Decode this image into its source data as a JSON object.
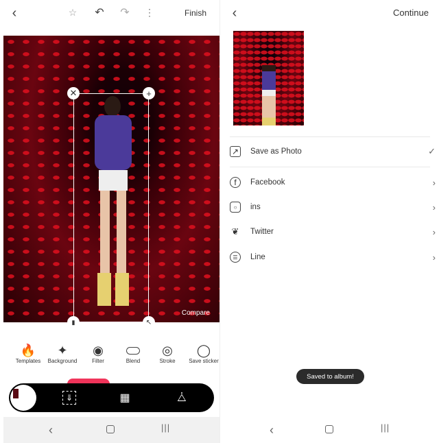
{
  "editor": {
    "header": {
      "finish_label": "Finish"
    },
    "compare_label": "Compare",
    "tools": [
      {
        "label": "Templates",
        "icon": "flame-icon"
      },
      {
        "label": "Background",
        "icon": "magic-wand-icon"
      },
      {
        "label": "Filter",
        "icon": "palette-icon"
      },
      {
        "label": "Blend",
        "icon": "toggle-icon"
      },
      {
        "label": "Stroke",
        "icon": "circle-ring-icon"
      },
      {
        "label": "Save sticker",
        "icon": "sticker-icon"
      }
    ],
    "accent": "#f0345a"
  },
  "share": {
    "header": {
      "continue_label": "Continue"
    },
    "options": [
      {
        "label": "Save as Photo",
        "icon": "image-icon",
        "trail": "check"
      },
      {
        "label": "Facebook",
        "icon": "facebook-icon",
        "trail": "chevron"
      },
      {
        "label": "ins",
        "icon": "instagram-icon",
        "trail": "chevron"
      },
      {
        "label": "Twitter",
        "icon": "twitter-icon",
        "trail": "chevron"
      },
      {
        "label": "Line",
        "icon": "line-icon",
        "trail": "chevron"
      }
    ],
    "toast": "Saved to album!"
  }
}
